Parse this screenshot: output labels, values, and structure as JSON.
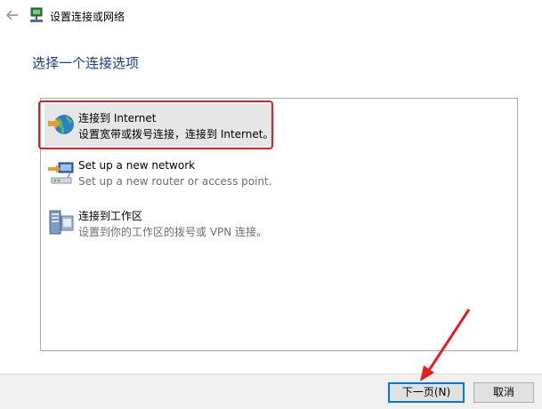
{
  "window": {
    "title": "设置连接或网络"
  },
  "heading": "选择一个连接选项",
  "options": [
    {
      "title": "连接到 Internet",
      "description": "设置宽带或拨号连接，连接到 Internet。",
      "icon": "globe-network-icon",
      "selected": true
    },
    {
      "title": "Set up a new network",
      "description": "Set up a new router or access point.",
      "icon": "router-icon",
      "selected": false
    },
    {
      "title": "连接到工作区",
      "description": "设置到你的工作区的拨号或 VPN 连接。",
      "icon": "workplace-server-icon",
      "selected": false
    }
  ],
  "buttons": {
    "next": "下一页(N)",
    "cancel": "取消"
  },
  "colors": {
    "heading": "#1c3a8c",
    "annotation": "#e02020",
    "accent": "#0078d7"
  }
}
